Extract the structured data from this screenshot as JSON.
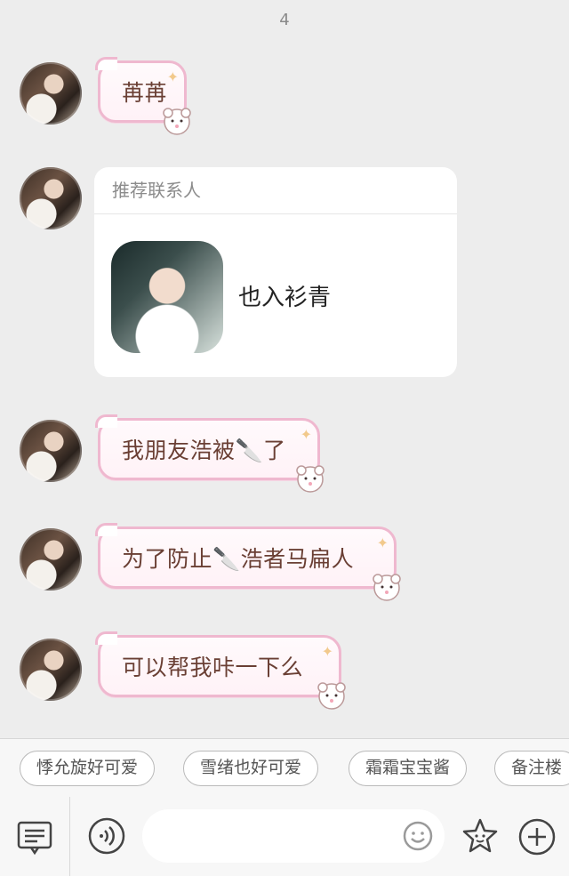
{
  "header": {
    "count": "4"
  },
  "messages": [
    {
      "type": "text",
      "text": "苒苒"
    },
    {
      "type": "contact",
      "card_title": "推荐联系人",
      "contact_name": "也入衫青"
    },
    {
      "type": "text",
      "text": "我朋友浩被🔪了"
    },
    {
      "type": "text",
      "text": "为了防止🔪浩者马扁人"
    },
    {
      "type": "text",
      "text": "可以帮我咔一下么"
    }
  ],
  "quick_replies": [
    "悸允旋好可爱",
    "雪绪也好可爱",
    "霜霜宝宝酱",
    "备注楼"
  ],
  "input": {
    "placeholder": ""
  },
  "icons": {
    "menu": "keyboard-menu-icon",
    "voice": "voice-icon",
    "emoji": "emoji-icon",
    "sticker": "star-face-icon",
    "plus": "plus-icon"
  },
  "colors": {
    "bubble_border": "#efb8cf",
    "text": "#6a3f34",
    "background": "#ededed"
  }
}
